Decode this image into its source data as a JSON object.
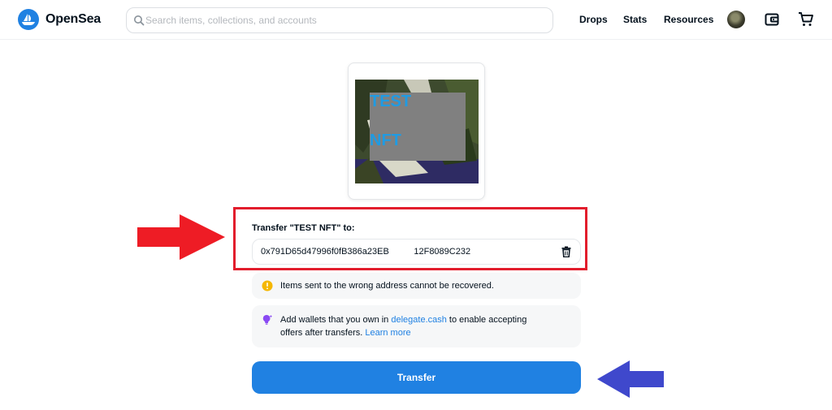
{
  "header": {
    "brand": "OpenSea",
    "search_placeholder": "Search items, collections, and accounts",
    "nav": [
      "Drops",
      "Stats",
      "Resources"
    ]
  },
  "nft": {
    "title_line1": "TEST",
    "title_line2": "NFT"
  },
  "transfer": {
    "label": "Transfer \"TEST NFT\" to:",
    "address": "0x791D65d47996f0fB386a23EB          12F8089C232",
    "warning": "Items sent to the wrong address cannot be recovered.",
    "delegate_before": "Add wallets that you own in ",
    "delegate_link": "delegate.cash",
    "delegate_middle": " to enable accepting",
    "delegate_line2": "offers after transfers. ",
    "learn_more": "Learn more",
    "button": "Transfer"
  },
  "colors": {
    "accent": "#2081e2",
    "highlight_box": "#e21d2c",
    "red_arrow": "#ee1c25",
    "blue_arrow": "#3f48cc",
    "warning_icon": "#f5b700",
    "bulb_icon": "#8a4af3"
  },
  "icons": [
    "opensea-logo-icon",
    "search-icon",
    "avatar",
    "wallet-icon",
    "cart-icon",
    "trash-icon",
    "warning-icon",
    "lightbulb-icon"
  ]
}
